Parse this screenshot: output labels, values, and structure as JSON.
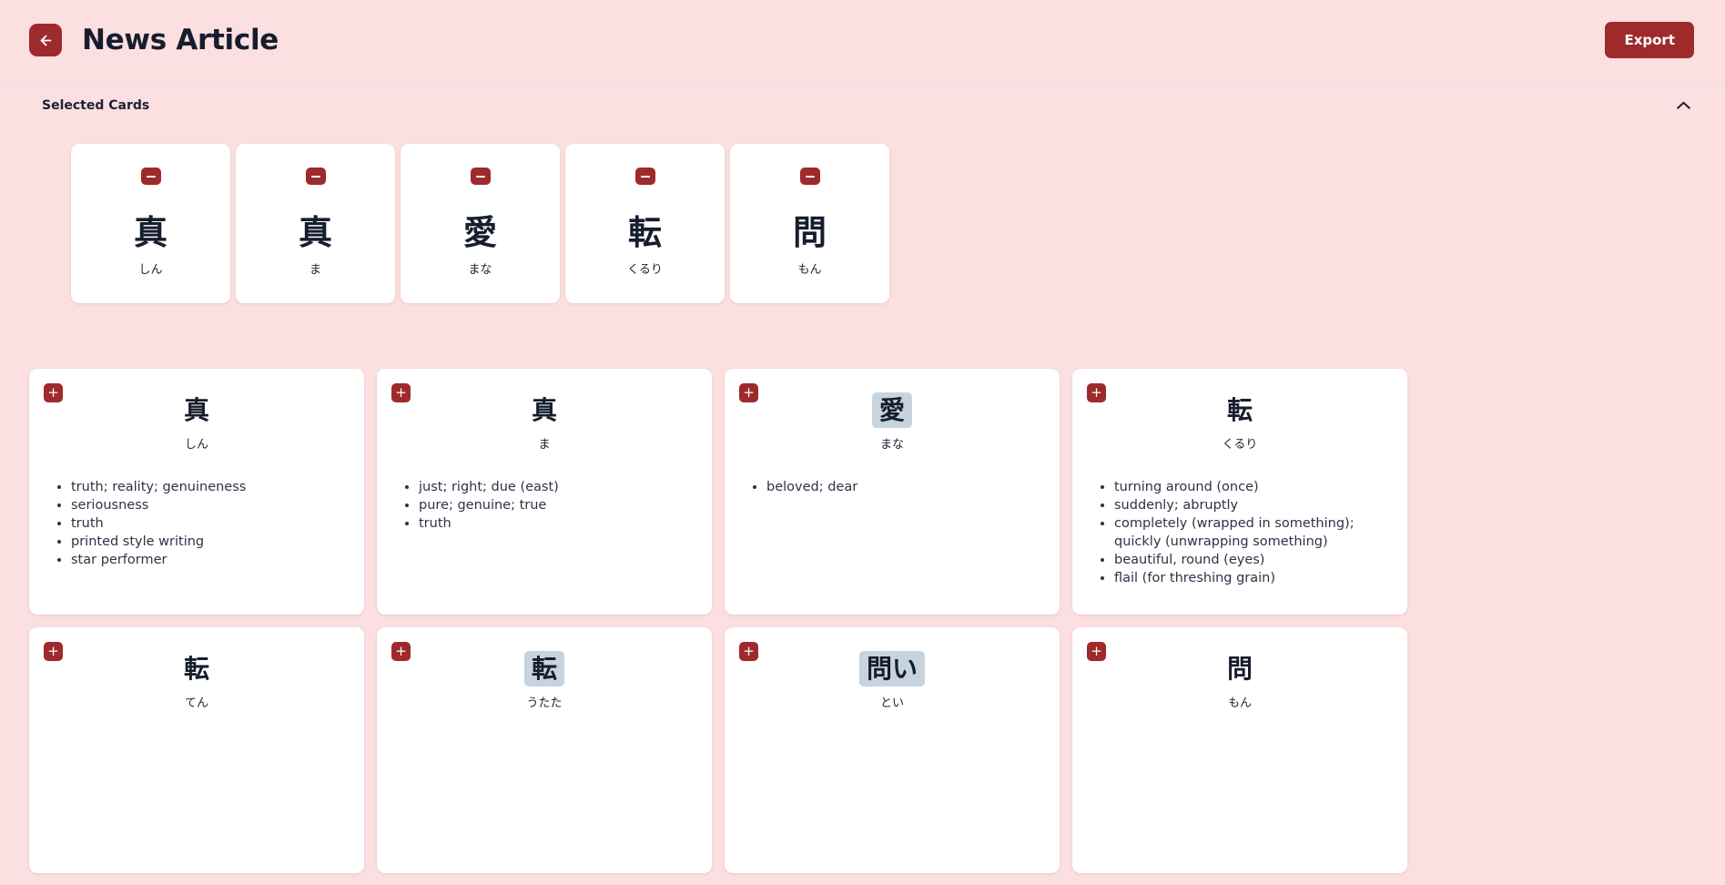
{
  "header": {
    "title": "News Article",
    "back_icon": "arrow-left-icon",
    "export_label": "Export"
  },
  "selected_section": {
    "title": "Selected Cards",
    "collapse_icon": "chevron-up-icon",
    "remove_icon": "minus-icon",
    "cards": [
      {
        "kanji": "真",
        "reading": "しん"
      },
      {
        "kanji": "真",
        "reading": "ま"
      },
      {
        "kanji": "愛",
        "reading": "まな"
      },
      {
        "kanji": "転",
        "reading": "くるり"
      },
      {
        "kanji": "問",
        "reading": "もん"
      }
    ]
  },
  "results": {
    "add_icon": "plus-icon",
    "add_label": "+",
    "cards": [
      {
        "kanji": "真",
        "reading": "しん",
        "highlighted": false,
        "definitions": [
          "truth; reality; genuineness",
          "seriousness",
          "truth",
          "printed style writing",
          "star performer"
        ]
      },
      {
        "kanji": "真",
        "reading": "ま",
        "highlighted": false,
        "definitions": [
          "just; right; due (east)",
          "pure; genuine; true",
          "truth"
        ]
      },
      {
        "kanji": "愛",
        "reading": "まな",
        "highlighted": true,
        "definitions": [
          "beloved; dear"
        ]
      },
      {
        "kanji": "転",
        "reading": "くるり",
        "highlighted": false,
        "definitions": [
          "turning around (once)",
          "suddenly; abruptly",
          "completely (wrapped in something); quickly (unwrapping something)",
          "beautiful, round (eyes)",
          "flail (for threshing grain)"
        ]
      },
      {
        "kanji": "転",
        "reading": "てん",
        "highlighted": false,
        "definitions": []
      },
      {
        "kanji": "転",
        "reading": "うたた",
        "highlighted": true,
        "definitions": []
      },
      {
        "kanji": "問い",
        "reading": "とい",
        "highlighted": true,
        "definitions": []
      },
      {
        "kanji": "問",
        "reading": "もん",
        "highlighted": false,
        "definitions": []
      }
    ]
  },
  "colors": {
    "background": "#fcdfe0",
    "accent": "#9e2a2b",
    "card": "#ffffff",
    "highlight": "#c7d3de",
    "text": "#1b2234"
  }
}
